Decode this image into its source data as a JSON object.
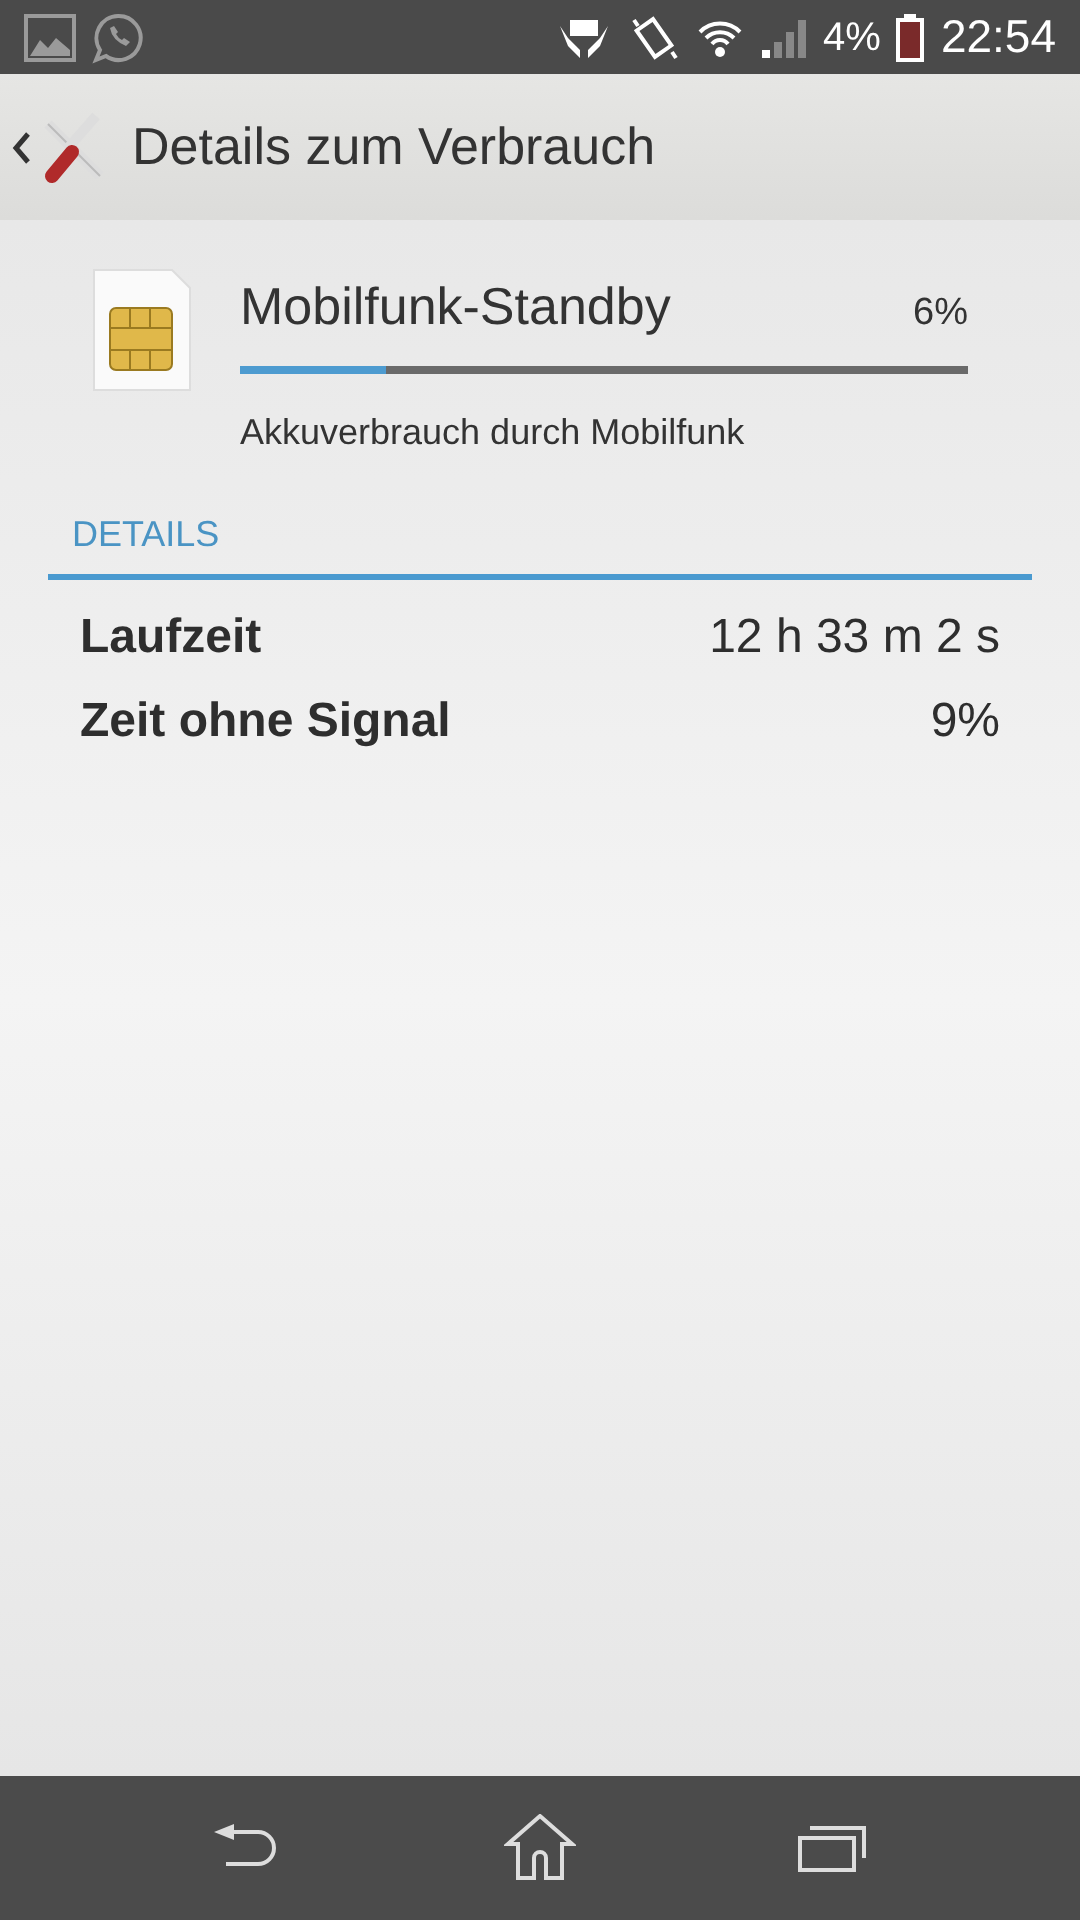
{
  "status_bar": {
    "battery": "4%",
    "time": "22:54"
  },
  "action_bar": {
    "title": "Details zum Verbrauch"
  },
  "usage": {
    "title": "Mobilfunk-Standby",
    "percent": "6%",
    "level": 0.2,
    "description": "Akkuverbrauch durch Mobilfunk"
  },
  "section": {
    "title": "DETAILS"
  },
  "rows": [
    {
      "label": "Laufzeit",
      "value": "12 h 33 m 2 s"
    },
    {
      "label": "Zeit ohne Signal",
      "value": "9%"
    }
  ]
}
